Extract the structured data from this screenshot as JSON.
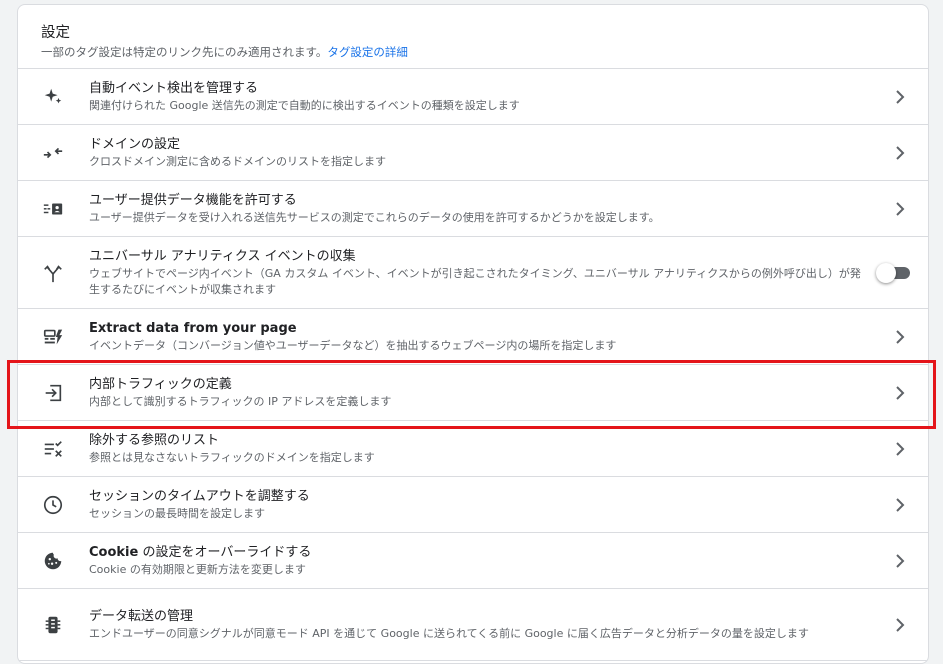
{
  "header": {
    "title": "設定",
    "subtitle": "一部のタグ設定は特定のリンク先にのみ適用されます。",
    "link": "タグ設定の詳細"
  },
  "rows": [
    {
      "title": "自動イベント検出を管理する",
      "desc": "関連付けられた Google 送信先の測定で自動的に検出するイベントの種類を設定します",
      "icon": "sparkle-icon",
      "control": "chevron"
    },
    {
      "title": "ドメインの設定",
      "desc": "クロスドメイン測定に含めるドメインのリストを指定します",
      "icon": "compress-arrows-icon",
      "control": "chevron"
    },
    {
      "title": "ユーザー提供データ機能を許可する",
      "desc": "ユーザー提供データを受け入れる送信先サービスの測定でこれらのデータの使用を許可するかどうかを設定します。",
      "icon": "user-data-icon",
      "control": "chevron"
    },
    {
      "title": "ユニバーサル アナリティクス イベントの収集",
      "desc": "ウェブサイトでページ内イベント（GA カスタム イベント、イベントが引き起こされたタイミング、ユニバーサル アナリティクスからの例外呼び出し）が発生するたびにイベントが収集されます",
      "icon": "merge-arrows-icon",
      "control": "toggle",
      "toggle_on": false
    },
    {
      "title": "Extract data from your page",
      "desc": "イベントデータ（コンバージョン値やユーザーデータなど）を抽出するウェブページ内の場所を指定します",
      "icon": "extract-data-icon",
      "control": "chevron"
    },
    {
      "title": "内部トラフィックの定義",
      "desc": "内部として識別するトラフィックの IP アドレスを定義します",
      "icon": "login-arrow-icon",
      "control": "chevron"
    },
    {
      "title": "除外する参照のリスト",
      "desc": "参照とは見なさないトラフィックのドメインを指定します",
      "icon": "exclude-list-icon",
      "control": "chevron"
    },
    {
      "title": "セッションのタイムアウトを調整する",
      "desc": "セッションの最長時間を設定します",
      "icon": "clock-icon",
      "control": "chevron"
    },
    {
      "title": "Cookie の設定をオーバーライドする",
      "title_bold_prefix": "Cookie",
      "desc": "Cookie の有効期限と更新方法を変更します",
      "icon": "cookie-icon",
      "control": "chevron"
    },
    {
      "title": "データ転送の管理",
      "desc": "エンドユーザーの同意シグナルが同意モード API を通じて Google に送られてくる前に Google に届く広告データと分析データの量を設定します",
      "icon": "data-transfer-icon",
      "control": "chevron"
    }
  ],
  "colors": {
    "link": "#1a73e8",
    "highlight": "#e4151a",
    "icon": "#3c4043",
    "chevron": "#5f6368"
  }
}
